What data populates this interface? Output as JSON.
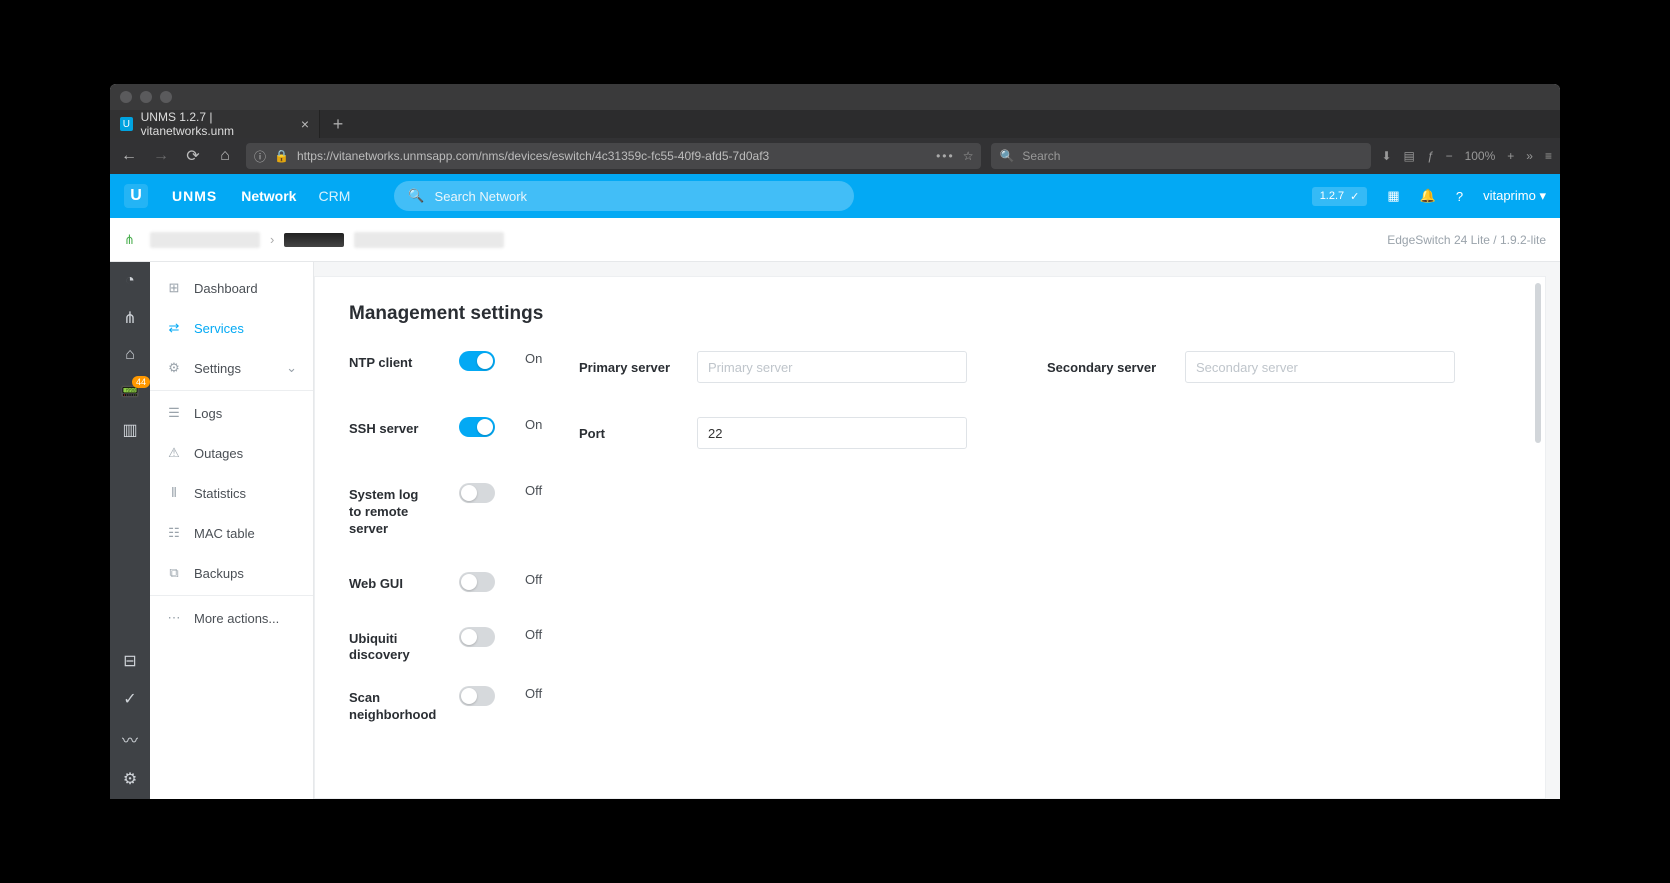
{
  "browser": {
    "tab_title": "UNMS 1.2.7 | vitanetworks.unm",
    "url": "https://vitanetworks.unmsapp.com/nms/devices/eswitch/4c31359c-fc55-40f9-afd5-7d0af3",
    "search_placeholder": "Search",
    "zoom": "100%"
  },
  "app": {
    "brand": "UNMS",
    "nav_network": "Network",
    "nav_crm": "CRM",
    "search_placeholder": "Search Network",
    "version": "1.2.7",
    "user": "vitaprimo"
  },
  "breadcrumb": {
    "device_info": "EdgeSwitch 24 Lite / 1.9.2-lite"
  },
  "rail": {
    "badge": "44"
  },
  "subnav": {
    "dashboard": "Dashboard",
    "services": "Services",
    "settings": "Settings",
    "logs": "Logs",
    "outages": "Outages",
    "statistics": "Statistics",
    "mac_table": "MAC table",
    "backups": "Backups",
    "more": "More actions..."
  },
  "page": {
    "title": "Management settings",
    "ntp": {
      "label": "NTP client",
      "state": "On",
      "primary_label": "Primary server",
      "primary_placeholder": "Primary server",
      "secondary_label": "Secondary server",
      "secondary_placeholder": "Secondary server"
    },
    "ssh": {
      "label": "SSH server",
      "state": "On",
      "port_label": "Port",
      "port_value": "22"
    },
    "syslog": {
      "label": "System log to remote server",
      "state": "Off"
    },
    "webgui": {
      "label": "Web GUI",
      "state": "Off"
    },
    "discovery": {
      "label": "Ubiquiti discovery",
      "state": "Off"
    },
    "scan": {
      "label": "Scan neighborhood",
      "state": "Off"
    }
  }
}
